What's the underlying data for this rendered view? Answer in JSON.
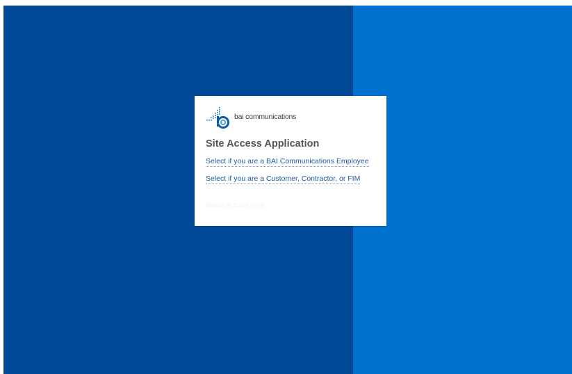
{
  "colors": {
    "left_panel": "#024a98",
    "right_panel": "#0071ce",
    "card": "#ffffff",
    "link": "#1f5aa3",
    "title": "#555555"
  },
  "logo": {
    "icon": "bai-logo-icon",
    "text": "bai communications"
  },
  "card": {
    "title": "Site Access Application",
    "links": [
      {
        "label": "Select if you are a BAI Communications Employee"
      },
      {
        "label": "Select if you are a Customer, Contractor, or FIM"
      }
    ],
    "faint_lines": [
      "",
      "Return to home page"
    ]
  }
}
